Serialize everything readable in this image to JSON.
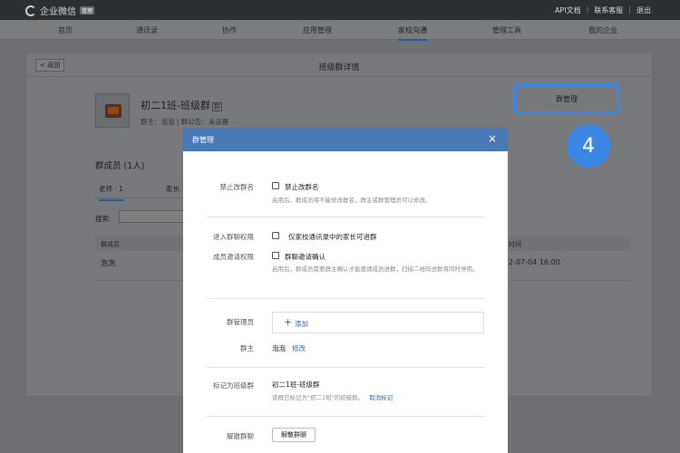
{
  "topbar": {
    "brand": "企业微信",
    "badge": "管理",
    "links": [
      "API文档",
      "联系客服",
      "退出"
    ]
  },
  "nav": {
    "items": [
      "首页",
      "通讯录",
      "协作",
      "应用管理",
      "家校沟通",
      "管理工具",
      "我的企业"
    ],
    "active": "家校沟通"
  },
  "page": {
    "back": "返回",
    "title": "班级群详情",
    "group_name": "初二1班-班级群",
    "group_tag": "群",
    "group_meta": "群主：泡泡 | 群公告：未设置",
    "manage_button": "群管理",
    "members_title": "群成员 (1人)",
    "tabs": [
      "老师 · 1",
      "家长"
    ],
    "search_label": "搜索:",
    "table_header_left": "群成员",
    "table_cell_left": "泡泡",
    "table_header_right": "时间",
    "table_cell_right": "2-07-04 16:00",
    "step_number": "4"
  },
  "modal": {
    "title": "群管理",
    "close_symbol": "×",
    "rename": {
      "label": "禁止改群名",
      "option": "禁止改群名",
      "hint": "启用后，群成员将不能修改群名，群主或群管理员可以修改。"
    },
    "permission": {
      "label": "进入群聊权限",
      "option": "仅家校通讯录中的家长可进群"
    },
    "invite": {
      "label": "成员邀请权限",
      "option": "群聊邀请确认",
      "hint": "启用后，群成员需要群主确认才能邀请成员进群，扫描二维码进群将同时停用。"
    },
    "admins": {
      "label": "群管理员",
      "add_text": "添加"
    },
    "owner": {
      "label": "群主",
      "value": "泡泡",
      "edit": "修改"
    },
    "class_group": {
      "label": "标记为班级群",
      "value": "初二1班-班级群",
      "hint": "该群已标记为\"初二1班\"的班级群。",
      "cancel_link": "取消标记"
    },
    "dissolve": {
      "label": "解散群聊",
      "button": "解散群聊"
    }
  },
  "colors": {
    "accent": "#3c86e6",
    "modal_header": "#4a7ab5",
    "link": "#3466a8"
  }
}
